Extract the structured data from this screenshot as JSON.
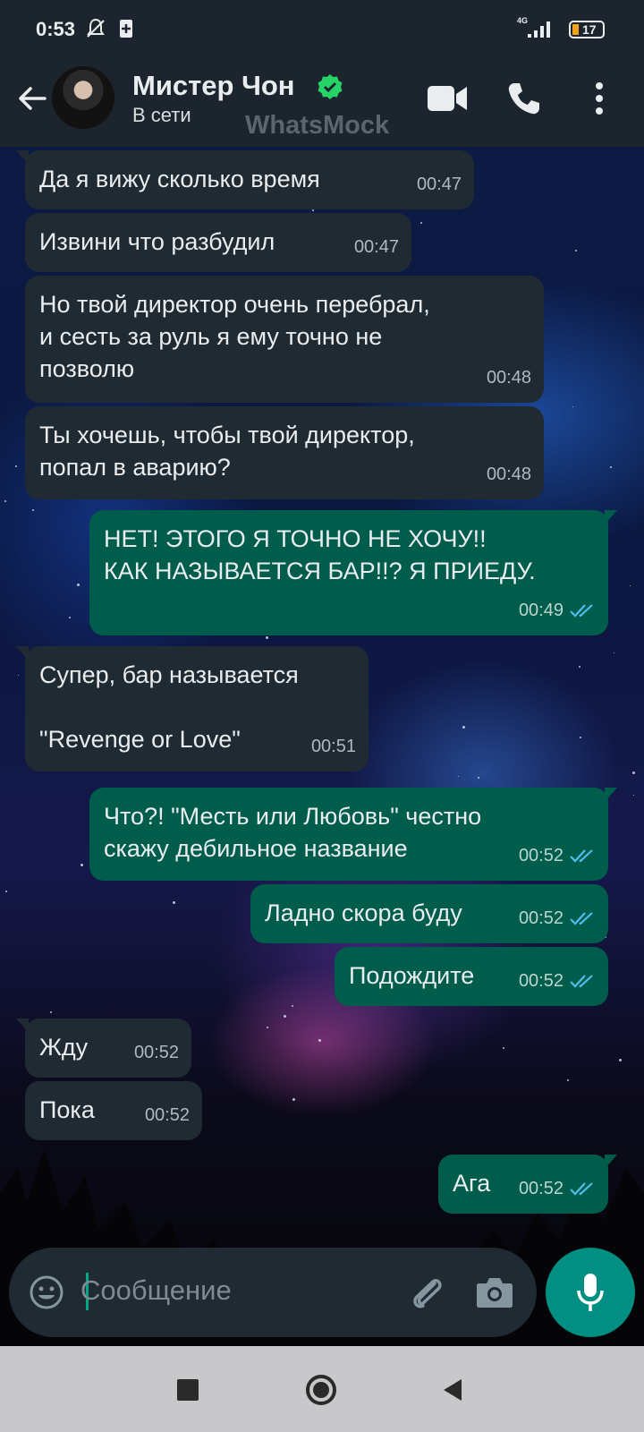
{
  "status_bar": {
    "time": "0:53",
    "network": "4G",
    "battery": "17"
  },
  "header": {
    "contact_name": "Мистер Чон",
    "status": "В сети",
    "watermark": "WhatsMock",
    "icons": [
      "back-arrow-icon",
      "verified-badge-icon",
      "video-call-icon",
      "phone-icon",
      "more-icon"
    ]
  },
  "messages": [
    {
      "dir": "in",
      "text": "Да я вижу сколько время",
      "time": "00:47"
    },
    {
      "dir": "in",
      "text": "Извини что разбудил",
      "time": "00:47"
    },
    {
      "dir": "in",
      "text": "Но твой директор очень перебрал,\nи сесть за руль я ему точно не\nпозволю",
      "time": "00:48"
    },
    {
      "dir": "in",
      "text": "Ты хочешь, чтобы твой директор,\nпопал в аварию?",
      "time": "00:48"
    },
    {
      "dir": "out",
      "text": "НЕТ! ЭТОГО Я ТОЧНО НЕ ХОЧУ!!\nКАК НАЗЫВАЕТСЯ БАР!!? Я ПРИЕДУ.",
      "time": "00:49",
      "read": true
    },
    {
      "dir": "in",
      "text": "Супер, бар называется\n\n\"Revenge or Love\"",
      "time": "00:51"
    },
    {
      "dir": "out",
      "text": "Что?! \"Месть или Любовь\" честно\nскажу дебильное название",
      "time": "00:52",
      "read": true
    },
    {
      "dir": "out",
      "text": "Ладно скора буду",
      "time": "00:52",
      "read": true
    },
    {
      "dir": "out",
      "text": "Подождите",
      "time": "00:52",
      "read": true
    },
    {
      "dir": "in",
      "text": "Жду",
      "time": "00:52"
    },
    {
      "dir": "in",
      "text": "Пока",
      "time": "00:52"
    },
    {
      "dir": "out",
      "text": "Ага",
      "time": "00:52",
      "read": true
    }
  ],
  "composer": {
    "placeholder": "Сообщение",
    "icons": [
      "emoji-icon",
      "attach-icon",
      "camera-icon",
      "mic-icon"
    ]
  },
  "nav": [
    "recents-square-icon",
    "home-circle-icon",
    "back-triangle-icon"
  ],
  "colors": {
    "incoming": "#1f2a33",
    "outgoing": "#005c4b",
    "read_tick": "#53bdeb",
    "accent": "#00a884"
  }
}
